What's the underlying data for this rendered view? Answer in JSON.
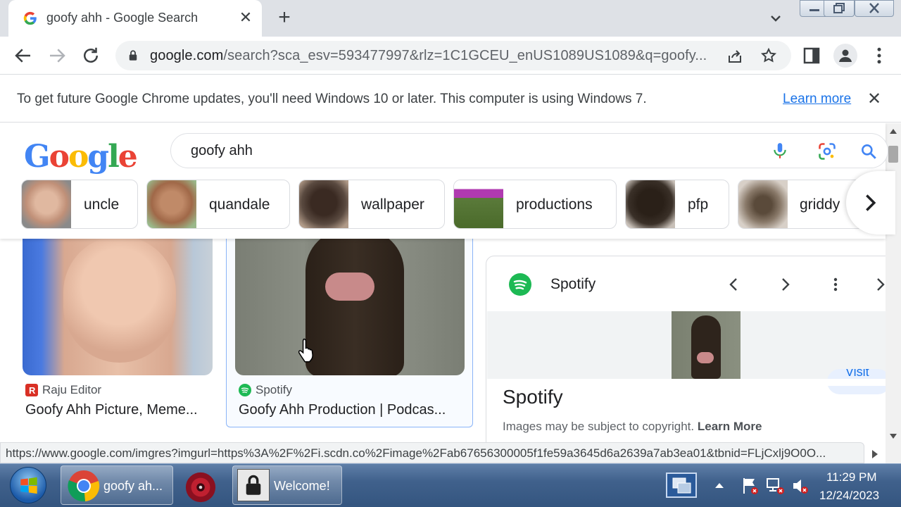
{
  "browser": {
    "tab_title": "goofy ahh - Google Search",
    "url_host": "google.com",
    "url_rest": "/search?sca_esv=593477997&rlz=1C1GCEU_enUS1089US1089&q=goofy..."
  },
  "infobar": {
    "message": "To get future Google Chrome updates, you'll need Windows 10 or later. This computer is using Windows 7.",
    "link": "Learn more"
  },
  "search": {
    "query": "goofy ahh"
  },
  "chips": [
    {
      "label": "uncle"
    },
    {
      "label": "quandale"
    },
    {
      "label": "wallpaper"
    },
    {
      "label": "productions"
    },
    {
      "label": "pfp"
    },
    {
      "label": "griddy"
    }
  ],
  "results": [
    {
      "source": "Raju Editor",
      "title": "Goofy Ahh Picture, Meme..."
    },
    {
      "source": "Spotify",
      "title": "Goofy Ahh Production | Podcas..."
    }
  ],
  "panel": {
    "source": "Spotify",
    "title": "Spotify",
    "copyright": "Images may be subject to copyright.",
    "copyright_link": "Learn More",
    "visit_label": "Visit"
  },
  "status_url": "https://www.google.com/imgres?imgurl=https%3A%2F%2Fi.scdn.co%2Fimage%2Fab67656300005f1fe59a3645d6a2639a7ab3ea01&tbnid=FLjCxlj9O0O...",
  "taskbar": {
    "chrome_label": "goofy ah...",
    "welcome_label": "Welcome!",
    "time": "11:29 PM",
    "date": "12/24/2023"
  },
  "colors": {
    "accent": "#1a73e8",
    "spotify": "#1db954",
    "raju_badge": "#d93025"
  }
}
